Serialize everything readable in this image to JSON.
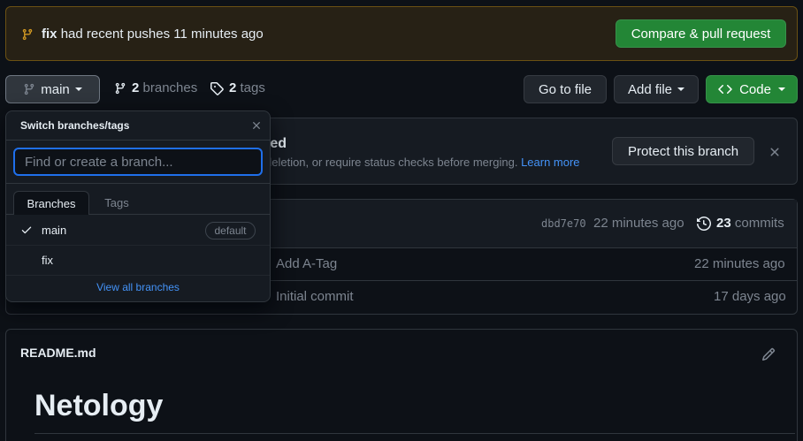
{
  "banner": {
    "branch": "fix",
    "message": "had recent pushes 11 minutes ago",
    "compare_label": "Compare & pull request"
  },
  "toolbar": {
    "branch_label": "main",
    "branches_count": "2",
    "branches_label": "branches",
    "tags_count": "2",
    "tags_label": "tags",
    "goto_label": "Go to file",
    "addfile_label": "Add file",
    "code_label": "Code"
  },
  "protect": {
    "title_fragment": "ted",
    "text_fragment": "deletion, or require status checks before merging.",
    "learn_more": "Learn more",
    "button_label": "Protect this branch"
  },
  "commit": {
    "hash": "dbd7e70",
    "time": "22 minutes ago",
    "commits_count": "23",
    "commits_label": "commits"
  },
  "files": [
    {
      "message": "Add A-Tag",
      "time": "22 minutes ago"
    },
    {
      "message": "Initial commit",
      "time": "17 days ago"
    }
  ],
  "readme": {
    "filename": "README.md",
    "heading": "Netology"
  },
  "dropdown": {
    "title": "Switch branches/tags",
    "placeholder": "Find or create a branch...",
    "tabs": [
      "Branches",
      "Tags"
    ],
    "items": [
      {
        "name": "main",
        "badge": "default"
      },
      {
        "name": "fix"
      }
    ],
    "view_all": "View all branches"
  },
  "colors": {
    "accent_green": "#238636",
    "link_blue": "#4493f8",
    "banner_bg": "#272115",
    "banner_border": "#6b5113",
    "branch_icon": "#d29922"
  },
  "icons": [
    "git-branch-icon",
    "tag-icon",
    "code-icon",
    "history-icon",
    "close-icon",
    "check-icon",
    "pencil-icon"
  ]
}
